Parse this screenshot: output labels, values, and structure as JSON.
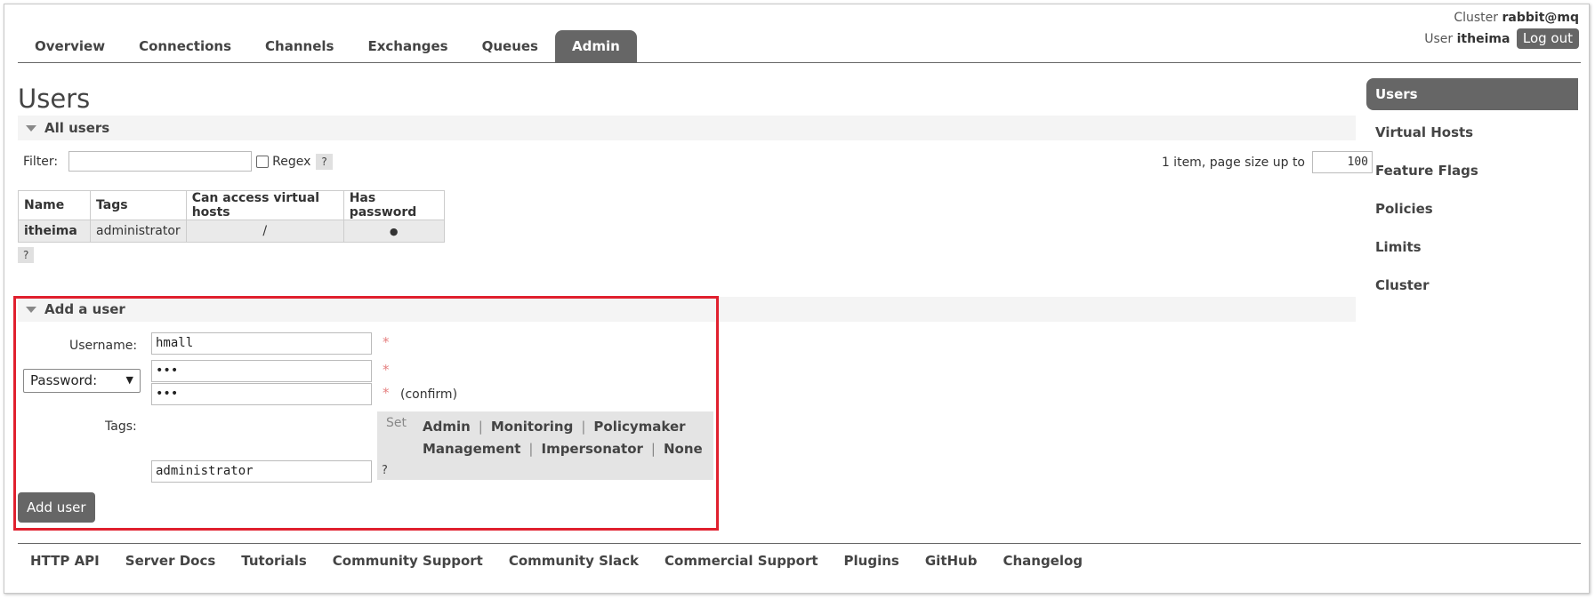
{
  "nav": {
    "tabs": [
      "Overview",
      "Connections",
      "Channels",
      "Exchanges",
      "Queues",
      "Admin"
    ],
    "active_tab": "Admin"
  },
  "cluster": {
    "label": "Cluster",
    "name": "rabbit@mq"
  },
  "user": {
    "label": "User",
    "name": "itheima",
    "logout": "Log out"
  },
  "page": {
    "title": "Users"
  },
  "all_users": {
    "header": "All users",
    "filter_label": "Filter:",
    "filter_value": "",
    "regex_label": "Regex",
    "regex_checked": false,
    "help": "?",
    "paging_text": "1 item, page size up to",
    "page_size": "100",
    "table": {
      "columns": [
        "Name",
        "Tags",
        "Can access virtual hosts",
        "Has password"
      ],
      "rows": [
        [
          "itheima",
          "administrator",
          "/",
          "●"
        ]
      ]
    }
  },
  "add_user": {
    "header": "Add a user",
    "username_label": "Username:",
    "username_value": "hmall",
    "password_select": "Password:",
    "password_value": "•••",
    "password_confirm_value": "•••",
    "confirm_label": "(confirm)",
    "required_mark": "*",
    "tags_label": "Tags:",
    "tags_set_label": "Set",
    "tag_options": [
      "Admin",
      "Monitoring",
      "Policymaker",
      "Management",
      "Impersonator",
      "None"
    ],
    "separator": "|",
    "tags_value": "administrator",
    "help": "?",
    "submit_label": "Add user",
    "highlight_color": "#e0202e"
  },
  "sidebar": {
    "items": [
      "Users",
      "Virtual Hosts",
      "Feature Flags",
      "Policies",
      "Limits",
      "Cluster"
    ],
    "active": "Users"
  },
  "footer": {
    "links": [
      "HTTP API",
      "Server Docs",
      "Tutorials",
      "Community Support",
      "Community Slack",
      "Commercial Support",
      "Plugins",
      "GitHub",
      "Changelog"
    ]
  }
}
